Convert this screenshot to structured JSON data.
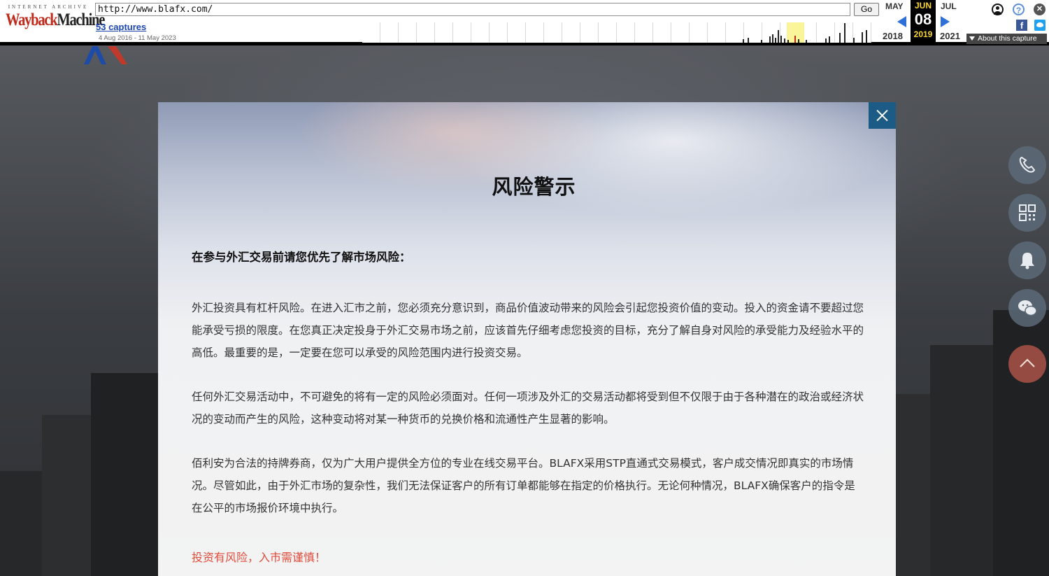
{
  "wayback": {
    "logo_top": "INTERNET ARCHIVE",
    "logo_main_a": "Wayback",
    "logo_main_b": "Machine",
    "url": "http://www.blafx.com/",
    "go_label": "Go",
    "captures": "53 captures",
    "range": "4 Aug 2016 - 11 May 2023",
    "prev_month": "MAY",
    "cur_month": "JUN",
    "next_month": "JUL",
    "cur_day": "08",
    "prev_year": "2018",
    "cur_year": "2019",
    "next_year": "2021",
    "about": "About this capture",
    "icons": [
      "user-icon",
      "help-icon",
      "close-icon",
      "facebook-icon",
      "twitter-icon"
    ]
  },
  "modal": {
    "title": "风险警示",
    "intro": "在参与外汇交易前请您优先了解市场风险：",
    "paragraphs": [
      "外汇投资具有杠杆风险。在进入汇市之前，您必须充分意识到，商品价值波动带来的风险会引起您投资价值的变动。投入的资金请不要超过您能承受亏损的限度。在您真正决定投身于外汇交易市场之前，应该首先仔细考虑您投资的目标，充分了解自身对风险的承受能力及经验水平的高低。最重要的是，一定要在您可以承受的风险范围内进行投资交易。",
      "任何外汇交易活动中，不可避免的将有一定的风险必须面对。任何一项涉及外汇的交易活动都将受到但不仅限于由于各种潜在的政治或经济状况的变动而产生的风险，这种变动将对某一种货币的兑换价格和流通性产生显著的影响。",
      "佰利安为合法的持牌券商，仅为广大用户提供全方位的专业在线交易平台。BLAFX采用STP直通式交易模式，客户成交情况即真实的市场情况。尽管如此，由于外汇市场的复杂性，我们无法保证客户的所有订单都能够在指定的价格执行。无论何种情况，BLAFX确保客户的指令是在公平的市场报价环境中执行。"
    ],
    "warning": "投资有风险，入市需谨慎！"
  },
  "side_buttons": [
    "phone-icon",
    "qrcode-icon",
    "bell-icon",
    "wechat-icon",
    "arrow-up-icon"
  ],
  "colors": {
    "accent": "#1b5b86",
    "warning": "#e24b3a",
    "wayback_red": "#c02a1b"
  }
}
